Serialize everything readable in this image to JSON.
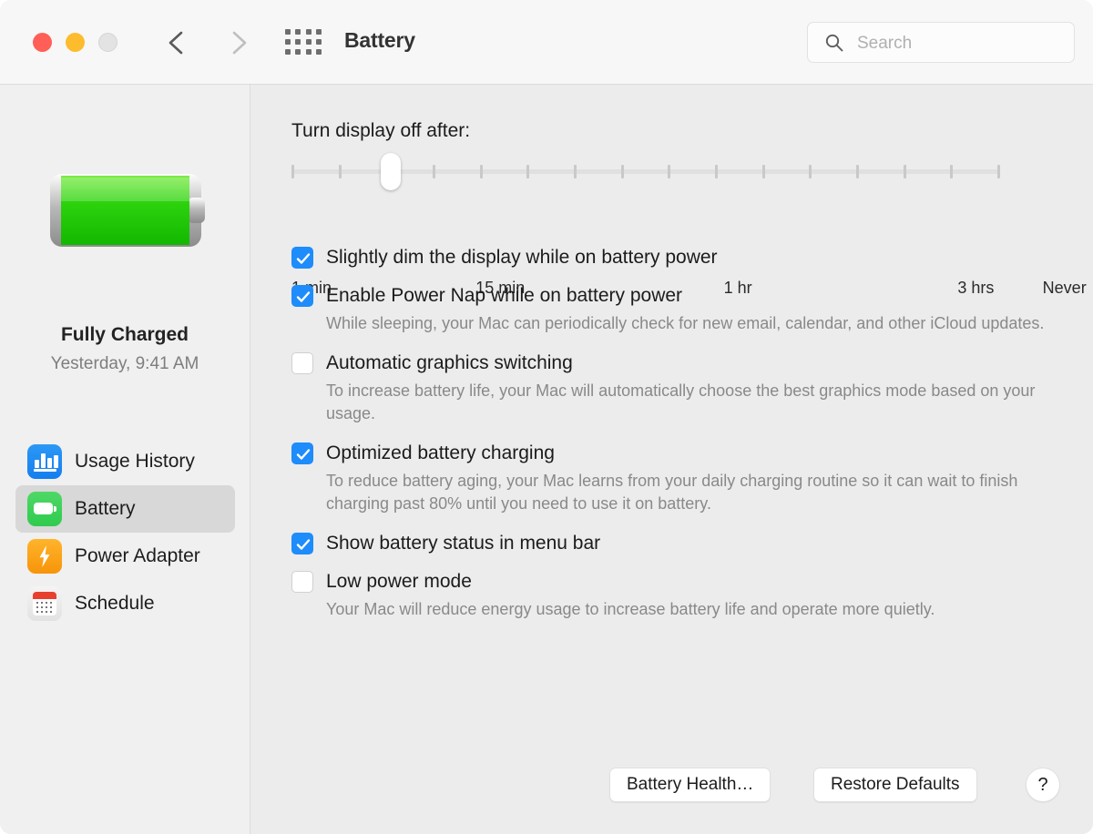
{
  "window": {
    "title": "Battery",
    "traffic_lights": [
      {
        "name": "close",
        "color": "#FF5F56"
      },
      {
        "name": "minimize",
        "color": "#FDBC2D"
      },
      {
        "name": "zoom",
        "color": "#E3E3E3"
      }
    ],
    "nav": {
      "back_icon": "chevron-left-icon",
      "forward_icon": "chevron-right-icon",
      "grid_icon": "show-all-grid-icon"
    }
  },
  "search": {
    "placeholder": "Search",
    "value": "",
    "icon": "search-icon"
  },
  "sidebar": {
    "battery_icon": "battery-full-green-icon",
    "status_title": "Fully Charged",
    "status_subtitle": "Yesterday, 9:41 AM",
    "items": [
      {
        "label": "Usage History",
        "icon": "chart-bar-icon",
        "selected": false,
        "accent": "#1E8CFB"
      },
      {
        "label": "Battery",
        "icon": "battery-icon",
        "selected": true,
        "accent": "#34C94E"
      },
      {
        "label": "Power Adapter",
        "icon": "bolt-icon",
        "selected": false,
        "accent": "#F79409"
      },
      {
        "label": "Schedule",
        "icon": "calendar-icon",
        "selected": false,
        "accent": "#E8402E"
      }
    ]
  },
  "main": {
    "slider": {
      "label": "Turn display off after:",
      "value_percent": 14,
      "tick_count": 16,
      "tick_labels": [
        {
          "text": "1 min",
          "percent": 0
        },
        {
          "text": "15 min",
          "percent": 26
        },
        {
          "text": "1 hr",
          "percent": 61
        },
        {
          "text": "3 hrs",
          "percent": 94
        },
        {
          "text": "Never",
          "percent": 106
        }
      ]
    },
    "options": [
      {
        "label": "Slightly dim the display while on battery power",
        "checked": true,
        "help": ""
      },
      {
        "label": "Enable Power Nap while on battery power",
        "checked": true,
        "help": "While sleeping, your Mac can periodically check for new email, calendar, and other iCloud updates."
      },
      {
        "label": "Automatic graphics switching",
        "checked": false,
        "help": "To increase battery life, your Mac will automatically choose the best graphics mode based on your usage."
      },
      {
        "label": "Optimized battery charging",
        "checked": true,
        "help": "To reduce battery aging, your Mac learns from your daily charging routine so it can wait to finish charging past 80% until you need to use it on battery."
      },
      {
        "label": "Show battery status in menu bar",
        "checked": true,
        "help": ""
      },
      {
        "label": "Low power mode",
        "checked": false,
        "help": "Your Mac will reduce energy usage to increase battery life and operate more quietly."
      }
    ],
    "footer": {
      "battery_health_label": "Battery Health…",
      "restore_defaults_label": "Restore Defaults",
      "help_label": "?"
    }
  },
  "colors": {
    "accent_blue": "#1E8CFB",
    "battery_green": "#2FCB4E",
    "titlebar_bg": "#F7F7F7",
    "sidebar_bg": "#F0F0F0",
    "main_bg": "#ECECEC"
  }
}
